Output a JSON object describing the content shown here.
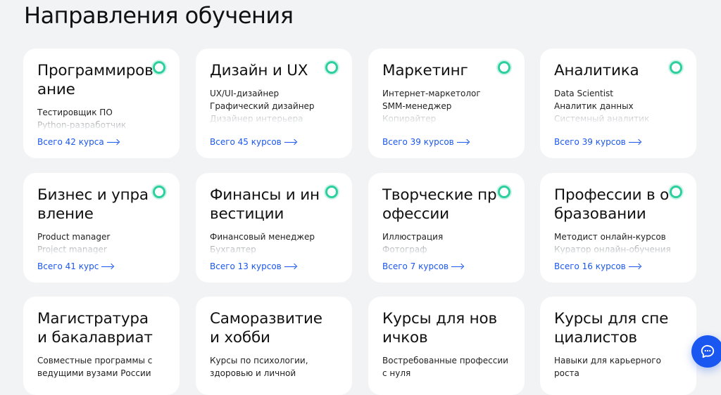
{
  "page": {
    "title": "Направления обучения"
  },
  "cards": [
    {
      "title": "Программирование",
      "items": [
        "Тестировщик ПО",
        "Python-разработчик"
      ],
      "link": "Всего 42 курса"
    },
    {
      "title": "Дизайн и UX",
      "items": [
        "UX/UI-дизайнер",
        "Графический дизайнер",
        "Дизайнер интерьера"
      ],
      "link": "Всего 45 курсов"
    },
    {
      "title": "Маркетинг",
      "items": [
        "Интернет-маркетолог",
        "SMM-менеджер",
        "Копирайтер"
      ],
      "link": "Всего 39 курсов"
    },
    {
      "title": "Аналитика",
      "items": [
        "Data Scientist",
        "Аналитик данных",
        "Системный аналитик"
      ],
      "link": "Всего 39 курсов"
    },
    {
      "title": "Бизнес и управление",
      "items": [
        "Product manager",
        "Project manager"
      ],
      "link": "Всего 41 курс"
    },
    {
      "title": "Финансы и инвестиции",
      "items": [
        "Финансовый менеджер",
        "Бухгалтер"
      ],
      "link": "Всего 13 курсов"
    },
    {
      "title": "Творческие профессии",
      "items": [
        "Иллюстрация",
        "Фотограф"
      ],
      "link": "Всего 7 курсов"
    },
    {
      "title": "Профессии в образовании",
      "items": [
        "Методист онлайн-курсов",
        "Куратор онлайн-обучения"
      ],
      "link": "Всего 16 курсов"
    },
    {
      "title": "Магистратура и бакалавриат",
      "desc": "Совместные программы с ведущими вузами России"
    },
    {
      "title": "Саморазвитие и хобби",
      "desc": "Курсы по психологии, здоровью и личной"
    },
    {
      "title": "Курсы для новичков",
      "desc": "Востребованные профессии с нуля"
    },
    {
      "title": "Курсы для специалистов",
      "desc": "Навыки для карьерного роста"
    }
  ],
  "chat": {
    "icon": "chat-icon",
    "accent": "#1a56f0"
  },
  "colors": {
    "accent": "#1a56f0",
    "dot": "#2ecf9e",
    "background": "#f2f3f5"
  }
}
